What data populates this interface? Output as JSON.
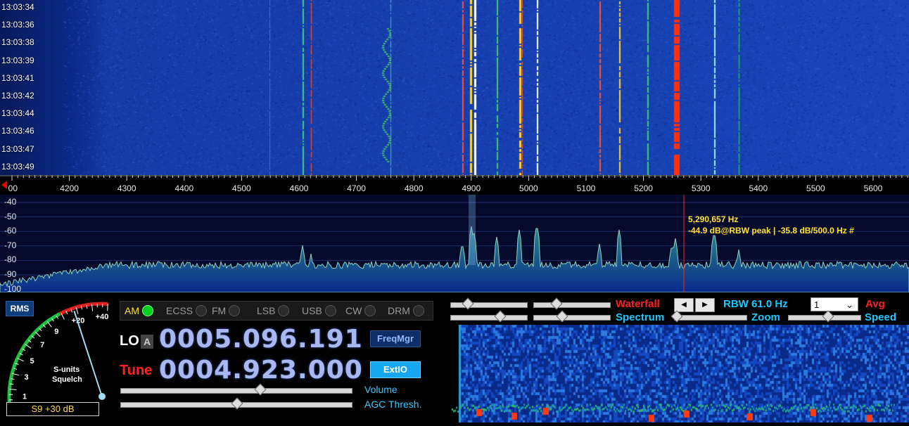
{
  "waterfall": {
    "timestamps": [
      "13:03:34",
      "13:03:36",
      "13:03:38",
      "13:03:39",
      "13:03:41",
      "13:03:42",
      "13:03:44",
      "13:03:46",
      "13:03:47",
      "13:03:49"
    ]
  },
  "freq_axis": {
    "labels": [
      "00",
      "4200",
      "4300",
      "4400",
      "4500",
      "4600",
      "4700",
      "4800",
      "4900",
      "5000",
      "5100",
      "5200",
      "5300",
      "5400",
      "5500",
      "5600"
    ]
  },
  "spectrum": {
    "db_labels": [
      "-40",
      "-50",
      "-60",
      "-70",
      "-80",
      "-90",
      "-100"
    ],
    "readout_freq": "5,290,657 Hz",
    "readout_level": "-44.9 dB@RBW peak | -35.8 dB/500.0 Hz #"
  },
  "smeter": {
    "rms_label": "RMS",
    "scale": [
      "1",
      "3",
      "5",
      "7",
      "9",
      "+20",
      "+40"
    ],
    "title_line1": "S-units",
    "title_line2": "Squelch",
    "readout": "S9 +30 dB"
  },
  "modes": [
    {
      "label": "AM",
      "active": true
    },
    {
      "label": "ECSS",
      "active": false
    },
    {
      "label": "FM",
      "active": false
    },
    {
      "label": "LSB",
      "active": false
    },
    {
      "label": "USB",
      "active": false
    },
    {
      "label": "CW",
      "active": false
    },
    {
      "label": "DRM",
      "active": false
    }
  ],
  "lo": {
    "label": "LO",
    "a_label": "A",
    "value": "0005.096.191"
  },
  "tune": {
    "label": "Tune",
    "value": "0004.923.000"
  },
  "buttons": {
    "freqmgr": "FreqMgr",
    "extio": "ExtIO"
  },
  "sliders": {
    "volume_label": "Volume",
    "volume_value": 0.6,
    "agc_label": "AGC Thresh.",
    "agc_value": 0.5
  },
  "display": {
    "waterfall_label": "Waterfall",
    "spectrum_label": "Spectrum",
    "rbw_label": "RBW 61.0 Hz",
    "zoom_label": "Zoom",
    "avg_label": "Avg",
    "speed_label": "Speed",
    "avg_value": "1"
  },
  "colors": {
    "accent_red": "#ff2020",
    "accent_cyan": "#18c8ff",
    "digit": "#a9b9f0",
    "readout": "#ffe033"
  }
}
